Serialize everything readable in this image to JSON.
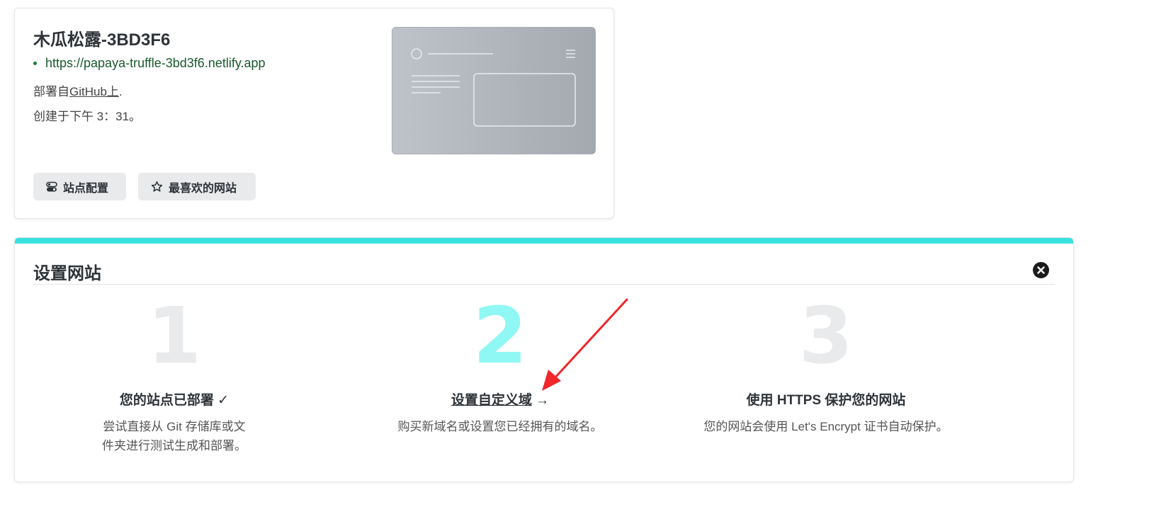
{
  "site": {
    "title": "木瓜松露-3BD3F6",
    "url": "https://papaya-truffle-3bd3f6.netlify.app",
    "deploy_prefix": "部署自",
    "deploy_link": "GitHub上",
    "deploy_suffix": ".",
    "created": "创建于下午 3：31。",
    "buttons": {
      "config_label": "站点配置",
      "favorite_label": "最喜欢的网站"
    }
  },
  "setup": {
    "title": "设置网站",
    "accent_color": "#3ae2df",
    "steps": [
      {
        "number": "1",
        "title": "您的站点已部署 ✓",
        "desc_line1": "尝试直接从 Git 存储库或文",
        "desc_line2": "件夹进行测试生成和部署。"
      },
      {
        "number": "2",
        "title": "设置自定义域",
        "arrow": "→",
        "desc": "购买新域名或设置您已经拥有的域名。"
      },
      {
        "number": "3",
        "title": "使用 HTTPS 保护您的网站",
        "desc": "您的网站会使用 Let's Encrypt 证书自动保护。"
      }
    ]
  },
  "icons": {
    "config": "toggle-icon",
    "favorite": "star-icon",
    "close": "close-circle-icon",
    "annotation": "red-arrow-annotation"
  }
}
